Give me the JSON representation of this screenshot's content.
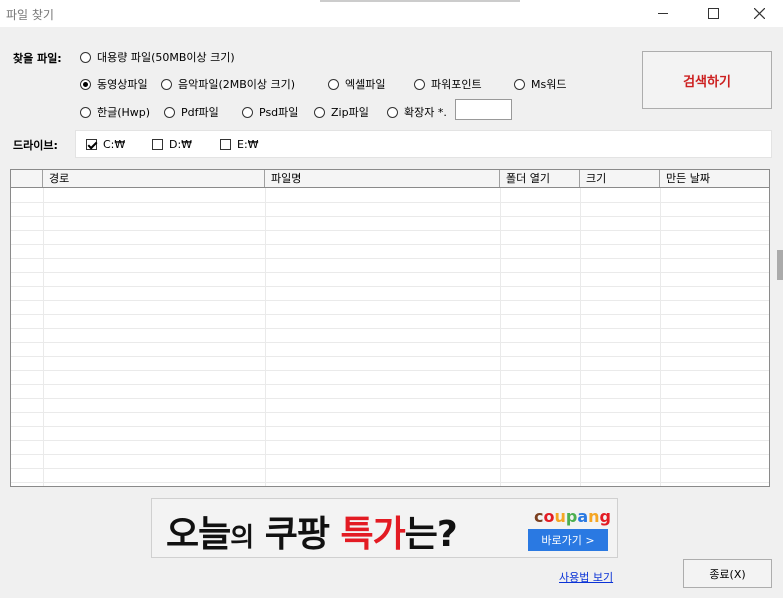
{
  "window": {
    "title": "파일 찾기"
  },
  "labels": {
    "file_type": "찾을 파일:",
    "drive": "드라이브:"
  },
  "file_types": [
    {
      "label": "대용량 파일(50MB이상 크기)",
      "selected": false
    },
    {
      "label": "동영상파일",
      "selected": true
    },
    {
      "label": "음악파일(2MB이상 크기)",
      "selected": false
    },
    {
      "label": "엑셀파일",
      "selected": false
    },
    {
      "label": "파워포인트",
      "selected": false
    },
    {
      "label": "Ms워드",
      "selected": false
    },
    {
      "label": "한글(Hwp)",
      "selected": false
    },
    {
      "label": "Pdf파일",
      "selected": false
    },
    {
      "label": "Psd파일",
      "selected": false
    },
    {
      "label": "Zip파일",
      "selected": false
    },
    {
      "label": "확장자 *.",
      "selected": false
    }
  ],
  "extension_input": {
    "value": ""
  },
  "search_button": {
    "label": "검색하기"
  },
  "drives": [
    {
      "label": "C:₩",
      "checked": true
    },
    {
      "label": "D:₩",
      "checked": false
    },
    {
      "label": "E:₩",
      "checked": false
    }
  ],
  "table": {
    "columns": [
      "",
      "경로",
      "파일명",
      "폴더 열기",
      "크기",
      "만든 날짜"
    ],
    "rows": []
  },
  "ad": {
    "slogan_1": "오늘",
    "slogan_2": "의",
    "slogan_3": " 쿠팡 ",
    "slogan_4": "특가",
    "slogan_5": "는?",
    "logo": "coupang",
    "button": "바로가기 >"
  },
  "footer": {
    "usage_link": "사용법 보기",
    "exit_button": "종료(X)"
  },
  "colors": {
    "accent_red": "#cc1f1f",
    "link_blue": "#0b33d6",
    "ad_button": "#2a79e2"
  }
}
